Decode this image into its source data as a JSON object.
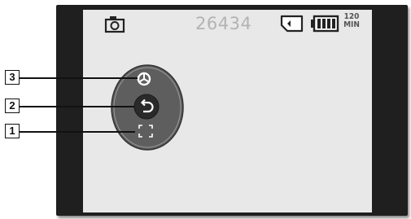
{
  "status_bar": {
    "shot_counter": "26434",
    "rec_time_line1": "120",
    "rec_time_line2": "MIN"
  },
  "callouts": [
    "3",
    "2",
    "1"
  ],
  "icons": {
    "camera": "camera-mode-icon",
    "card": "memory-card-icon",
    "battery": "battery-icon",
    "stabilizer": "anti-shake-icon",
    "back": "return-icon",
    "focus": "focus-frame-icon"
  },
  "colors": {
    "frame": "#1f1f1f",
    "screen": "#e8e8e8",
    "oval": "#5a5a5a",
    "button": "#222222"
  }
}
